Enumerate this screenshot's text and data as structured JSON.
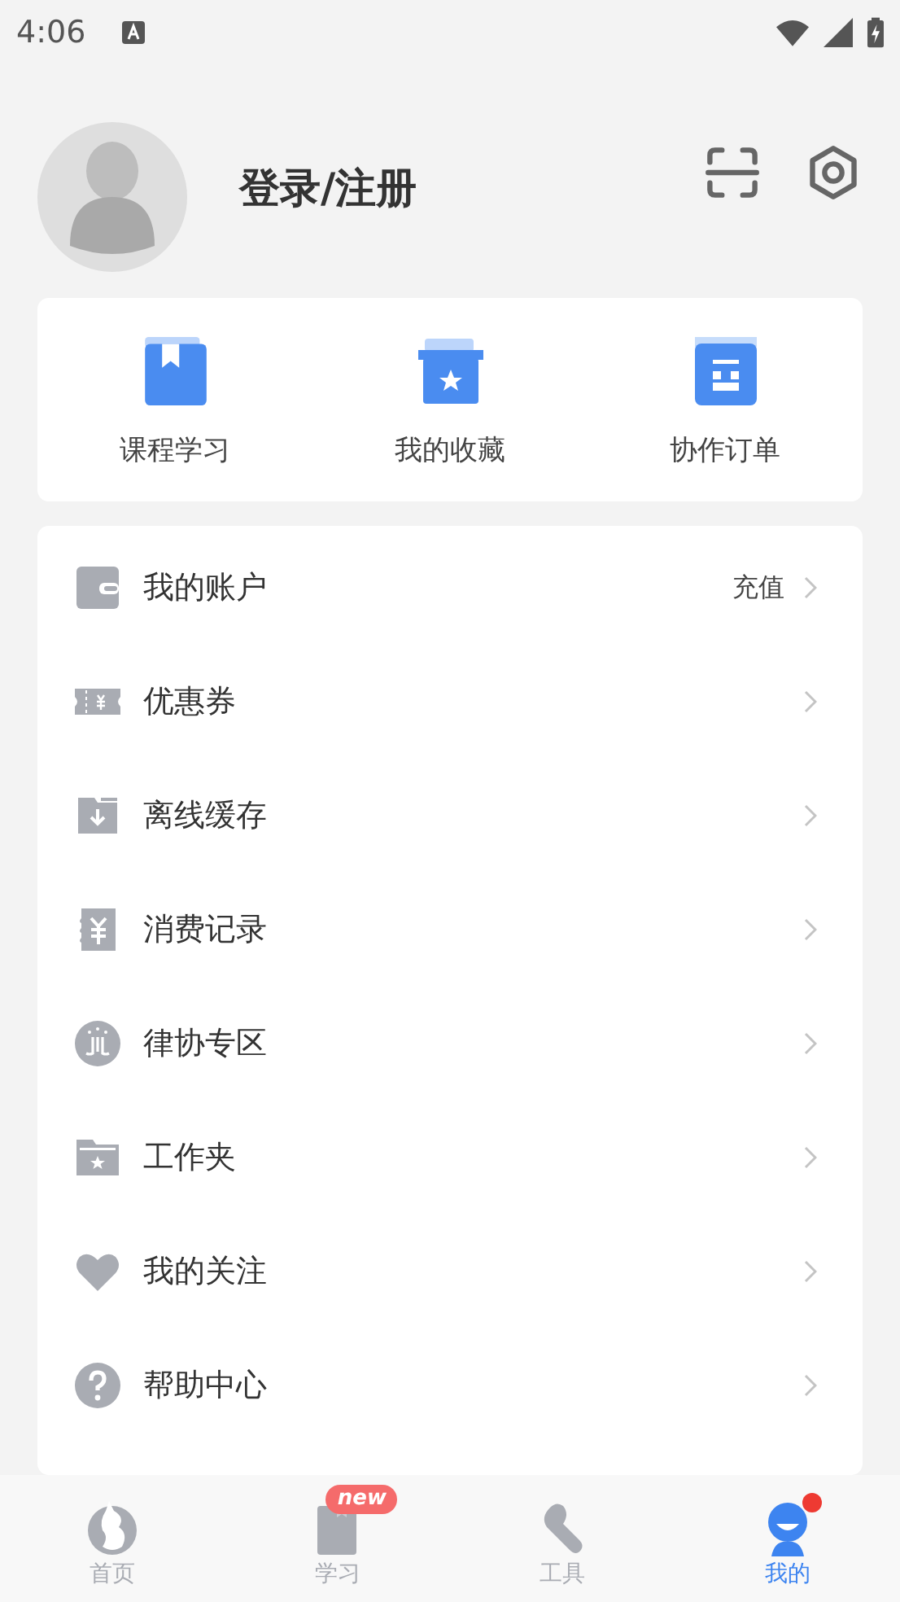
{
  "status_bar": {
    "time": "4:06"
  },
  "profile": {
    "login_label": "登录/注册"
  },
  "shortcuts": [
    {
      "kind": "book",
      "label": "课程学习"
    },
    {
      "kind": "box",
      "label": "我的收藏"
    },
    {
      "kind": "order",
      "label": "协作订单"
    }
  ],
  "menu": [
    {
      "kind": "wallet",
      "label": "我的账户",
      "value": "充值"
    },
    {
      "kind": "coupon",
      "label": "优惠券"
    },
    {
      "kind": "download",
      "label": "离线缓存"
    },
    {
      "kind": "receipt",
      "label": "消费记录"
    },
    {
      "kind": "emblem",
      "label": "律协专区"
    },
    {
      "kind": "folder",
      "label": "工作夹"
    },
    {
      "kind": "heart",
      "label": "我的关注"
    },
    {
      "kind": "help",
      "label": "帮助中心"
    }
  ],
  "tabs": [
    {
      "kind": "home",
      "label": "首页",
      "selected": false
    },
    {
      "kind": "study",
      "label": "学习",
      "selected": false,
      "badge": "new"
    },
    {
      "kind": "tools",
      "label": "工具",
      "selected": false
    },
    {
      "kind": "mine",
      "label": "我的",
      "selected": true,
      "dot": true
    }
  ]
}
